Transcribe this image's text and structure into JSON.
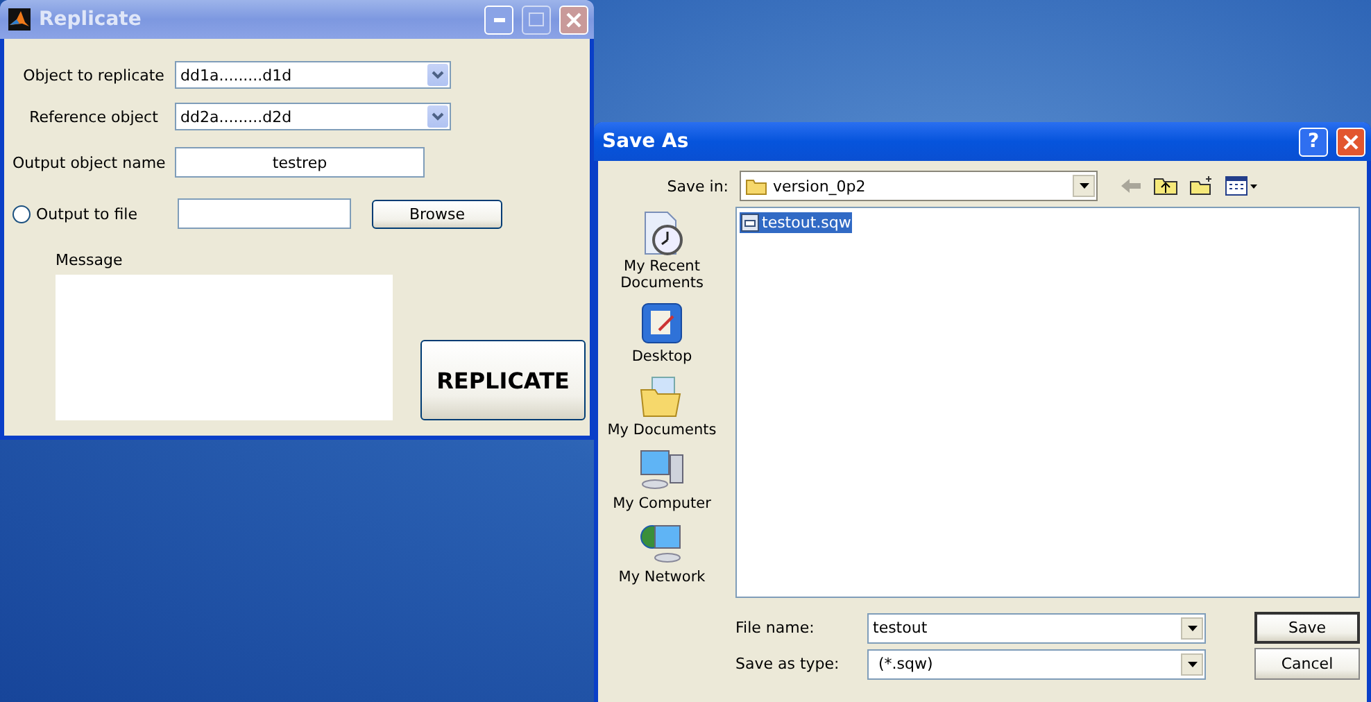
{
  "replicate_window": {
    "title": "Replicate",
    "object_to_replicate": {
      "label": "Object to replicate",
      "value": "dd1a.........d1d"
    },
    "reference_object": {
      "label": "Reference object",
      "value": "dd2a.........d2d"
    },
    "output_name": {
      "label": "Output object name",
      "value": "testrep"
    },
    "output_to_file": {
      "label": "Output to file",
      "selected": false
    },
    "browse_button": "Browse",
    "message": {
      "label": "Message"
    },
    "replicate_button": "REPLICATE"
  },
  "save_as_dialog": {
    "title": "Save As",
    "help_button": "?",
    "save_in": {
      "label": "Save in:",
      "value": "version_0p2"
    },
    "places": [
      {
        "kind": "recent",
        "label": "My Recent Documents"
      },
      {
        "kind": "desktop",
        "label": "Desktop"
      },
      {
        "kind": "documents",
        "label": "My Documents"
      },
      {
        "kind": "computer",
        "label": "My Computer"
      },
      {
        "kind": "network",
        "label": "My Network"
      }
    ],
    "files": [
      {
        "name": "testout.sqw",
        "selected": true
      }
    ],
    "file_name": {
      "label": "File name:",
      "value": "testout"
    },
    "save_as_type": {
      "label": "Save as type:",
      "value": "(*.sqw)"
    },
    "buttons": [
      "Save",
      "Cancel"
    ]
  }
}
